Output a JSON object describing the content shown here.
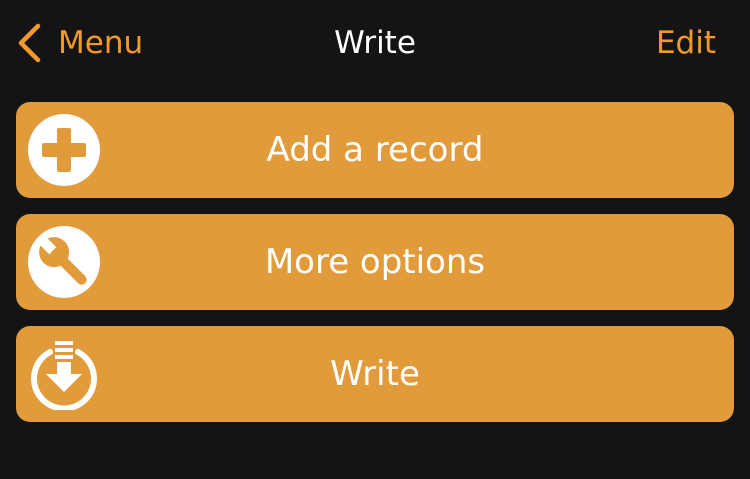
{
  "navbar": {
    "back_label": "Menu",
    "title": "Write",
    "edit_label": "Edit"
  },
  "actions": [
    {
      "label": "Add a record",
      "icon": "plus-circle-icon"
    },
    {
      "label": "More options",
      "icon": "wrench-icon"
    },
    {
      "label": "Write",
      "icon": "download-icon"
    }
  ],
  "colors": {
    "background": "#141414",
    "accent": "#f19a2b",
    "button": "#e19b3a",
    "text": "#ffffff"
  }
}
